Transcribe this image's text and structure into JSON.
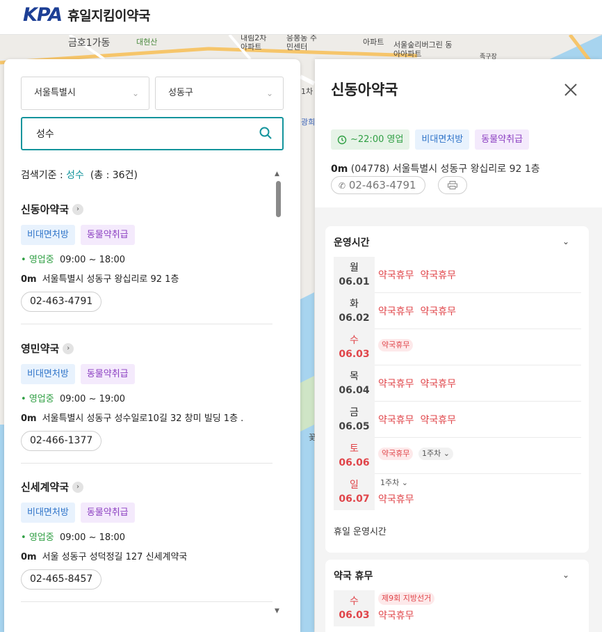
{
  "header": {
    "logo": "KPA",
    "title": "휴일지킴이약국"
  },
  "map": {
    "labels": [
      "금호1가동",
      "대현산",
      "내림2차 아파트",
      "응봉동 주민센터",
      "아파트",
      "서울숲리버그린 동아아파트",
      "족구장",
      "광희",
      "1차",
      "꽃"
    ]
  },
  "search": {
    "city": "서울특별시",
    "district": "성동구",
    "query": "성수",
    "criteria_label": "검색기준 :",
    "criteria_value": "성수",
    "count_text": "(총 : 36건)"
  },
  "results": [
    {
      "name": "신동아약국",
      "tags": [
        "비대면처방",
        "동물약취급"
      ],
      "status": "영업중",
      "hours": "09:00 ~ 18:00",
      "distance": "0m",
      "address": "서울특별시 성동구 왕십리로 92 1층",
      "phone": "02-463-4791"
    },
    {
      "name": "영민약국",
      "tags": [
        "비대면처방",
        "동물약취급"
      ],
      "status": "영업중",
      "hours": "09:00 ~ 19:00",
      "distance": "0m",
      "address": "서울특별시 성동구 성수일로10길 32 창미 빌딩 1층 .",
      "phone": "02-466-1377"
    },
    {
      "name": "신세계약국",
      "tags": [
        "비대면처방",
        "동물약취급"
      ],
      "status": "영업중",
      "hours": "09:00 ~ 18:00",
      "distance": "0m",
      "address": "서울 성동구 성덕정길 127 신세계약국",
      "phone": "02-465-8457"
    }
  ],
  "detail": {
    "title": "신동아약국",
    "tags": [
      "~22:00 영업",
      "비대면처방",
      "동물약취급"
    ],
    "distance": "0m",
    "address": "(04778) 서울특별시 성동구 왕십리로 92 1층",
    "phone": "02-463-4791",
    "hours_section": {
      "title": "운영시간",
      "rows": [
        {
          "day": "월",
          "date": "06.01",
          "entries": [
            "약국휴무",
            "약국휴무"
          ]
        },
        {
          "day": "화",
          "date": "06.02",
          "entries": [
            "약국휴무",
            "약국휴무"
          ]
        },
        {
          "day": "수",
          "date": "06.03",
          "entries": [
            "약국휴무"
          ]
        },
        {
          "day": "목",
          "date": "06.04",
          "entries": [
            "약국휴무",
            "약국휴무"
          ]
        },
        {
          "day": "금",
          "date": "06.05",
          "entries": [
            "약국휴무",
            "약국휴무"
          ]
        },
        {
          "day": "토",
          "date": "06.06",
          "entries": [
            "약국휴무"
          ],
          "week": "1주차"
        },
        {
          "day": "일",
          "date": "06.07",
          "entries": [
            "약국휴무"
          ],
          "week": "1주차"
        }
      ],
      "footer": "휴일 운영시간"
    },
    "closed_section": {
      "title": "약국 휴무",
      "rows": [
        {
          "day": "수",
          "date": "06.03",
          "badge": "제9회 지방선거",
          "entry": "약국휴무"
        }
      ]
    }
  }
}
